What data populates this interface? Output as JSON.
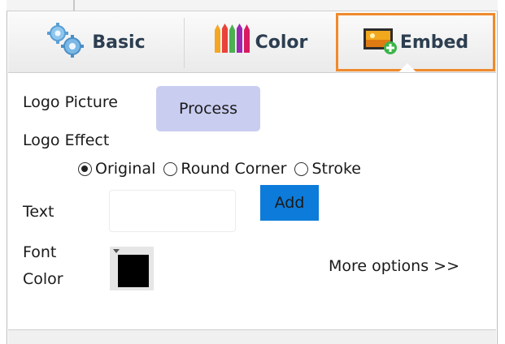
{
  "tabs": [
    {
      "label": "Basic",
      "icon": "gear-icon",
      "active": false
    },
    {
      "label": "Color",
      "icon": "crayons-icon",
      "active": false
    },
    {
      "label": "Embed",
      "icon": "embed-image-icon",
      "active": true
    }
  ],
  "accent_color": "#ef8a2c",
  "logo_picture": {
    "label": "Logo Picture",
    "button": "Process"
  },
  "logo_effect": {
    "label": "Logo Effect",
    "options": [
      "Original",
      "Round Corner",
      "Stroke"
    ],
    "selected": "Original"
  },
  "text": {
    "label": "Text",
    "value": "",
    "add_button": "Add"
  },
  "font_color": {
    "label_line1": "Font",
    "label_line2": "Color",
    "value": "#000000"
  },
  "more_options": "More options >>"
}
